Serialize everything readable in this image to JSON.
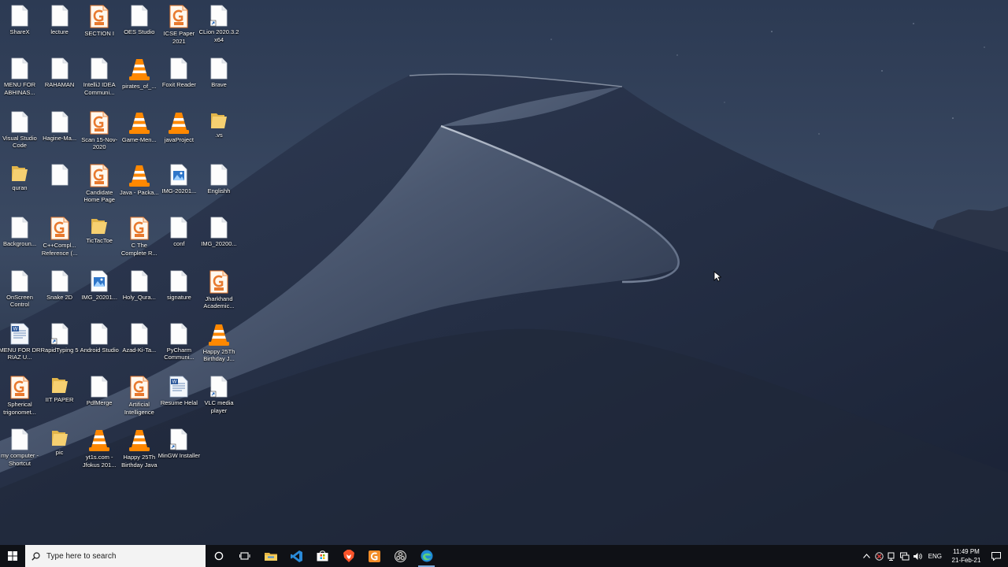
{
  "desktop": {
    "icons": [
      {
        "label": "ShareX",
        "type": "doc"
      },
      {
        "label": "lecture",
        "type": "doc"
      },
      {
        "label": "SECTION I",
        "type": "pdf"
      },
      {
        "label": "OES Studio",
        "type": "doc"
      },
      {
        "label": "ICSE Paper 2021",
        "type": "pdf"
      },
      {
        "label": "CLion 2020.3.2 x64",
        "type": "shortcut"
      },
      {
        "label": "MENU FOR ABHINAS...",
        "type": "doc"
      },
      {
        "label": "RAHAMAN",
        "type": "doc"
      },
      {
        "label": "IntelliJ IDEA Communi...",
        "type": "doc"
      },
      {
        "label": "pirates_of_...",
        "type": "vlc"
      },
      {
        "label": "Foxit Reader",
        "type": "doc"
      },
      {
        "label": "Brave",
        "type": "doc"
      },
      {
        "label": "Visual Studio Code",
        "type": "doc"
      },
      {
        "label": "Hagine-Ma...",
        "type": "doc"
      },
      {
        "label": "Scan 15-Nov-2020",
        "type": "pdf"
      },
      {
        "label": "Game-Men...",
        "type": "vlc"
      },
      {
        "label": "javaProject",
        "type": "vlc"
      },
      {
        "label": ".vs",
        "type": "folder"
      },
      {
        "label": "quran",
        "type": "folder"
      },
      {
        "label": "",
        "type": "doc"
      },
      {
        "label": "Candidate Home Page",
        "type": "pdf"
      },
      {
        "label": "Java - Packa...",
        "type": "vlc"
      },
      {
        "label": "IMG-20201...",
        "type": "image"
      },
      {
        "label": "Englishh",
        "type": "doc"
      },
      {
        "label": "Backgroun...",
        "type": "doc"
      },
      {
        "label": "C++Compl... Reference (...",
        "type": "pdf"
      },
      {
        "label": "TicTacToe",
        "type": "folder"
      },
      {
        "label": "C The Complete R...",
        "type": "pdf"
      },
      {
        "label": "conf",
        "type": "doc"
      },
      {
        "label": "IMG_20200...",
        "type": "doc"
      },
      {
        "label": "OnScreen Control",
        "type": "doc"
      },
      {
        "label": "Snake 2D",
        "type": "doc"
      },
      {
        "label": "IMG_20201...",
        "type": "image"
      },
      {
        "label": "Holy_Qura...",
        "type": "doc"
      },
      {
        "label": "signature",
        "type": "doc"
      },
      {
        "label": "Jharkhand Academic...",
        "type": "pdf"
      },
      {
        "label": "MENU FOR DR RIAZ U...",
        "type": "word"
      },
      {
        "label": "RapidTyping 5",
        "type": "shortcut"
      },
      {
        "label": "Android Studio",
        "type": "doc"
      },
      {
        "label": "Azad-Ki-Ta...",
        "type": "doc"
      },
      {
        "label": "PyCharm Communi...",
        "type": "doc"
      },
      {
        "label": "Happy 25Th Birthday J...",
        "type": "vlc"
      },
      {
        "label": "Spherical trigonomet...",
        "type": "pdf"
      },
      {
        "label": "IIT PAPER",
        "type": "folder"
      },
      {
        "label": "PdfMerge",
        "type": "doc"
      },
      {
        "label": "Artificial Intelligence",
        "type": "pdf"
      },
      {
        "label": "Resume Helal",
        "type": "word"
      },
      {
        "label": "VLC media player",
        "type": "shortcut"
      },
      {
        "label": "my computer - Shortcut",
        "type": "doc"
      },
      {
        "label": "pic",
        "type": "folder"
      },
      {
        "label": "yt1s.com - Jfokus 201...",
        "type": "vlc"
      },
      {
        "label": "Happy 25Th Birthday Java",
        "type": "vlc"
      },
      {
        "label": "MinGW Installer",
        "type": "shortcut"
      }
    ]
  },
  "taskbar": {
    "search_placeholder": "Type here to search",
    "apps": [
      "cortana-icon",
      "task-view-icon",
      "file-explorer-icon",
      "vscode-icon",
      "store-icon",
      "brave-icon",
      "foxit-icon",
      "obs-icon",
      "edge-icon"
    ],
    "active_app": "edge-icon",
    "tray": {
      "language": "ENG",
      "time": "11:49 PM",
      "date": "21-Feb-21"
    }
  },
  "colors": {
    "taskbar_bg": "#0f1116",
    "search_bg": "#f3f3f3",
    "folder": "#f0c966",
    "pdf": "#e8792d"
  }
}
